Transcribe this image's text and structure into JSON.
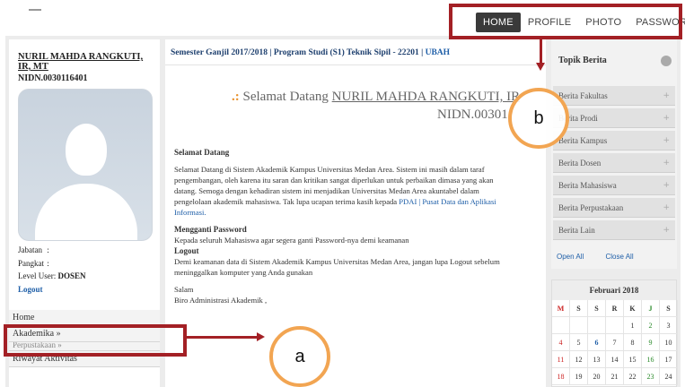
{
  "topnav": {
    "items": [
      "HOME",
      "PROFILE",
      "PHOTO",
      "PASSWORD"
    ],
    "active": "HOME"
  },
  "user": {
    "name": "NURIL MAHDA RANGKUTI, IR, MT",
    "nidn": "NIDN.0030116401",
    "jabatan_label": "Jabatan",
    "jabatan_value": ":",
    "pangkat_label": "Pangkat",
    "pangkat_value": ":",
    "level_label": "Level User:",
    "level_value": "DOSEN",
    "logout": "Logout"
  },
  "menu": {
    "home": "Home",
    "akademika": "Akademika »",
    "perpustakaan": "Perpustakaan »",
    "riwayat": "Riwayat Aktivitas"
  },
  "center": {
    "breadcrumb_main": "Semester Ganjil 2017/2018 | Program Studi (S1) Teknik Sipil - 22201 | ",
    "breadcrumb_link": "UBAH",
    "welcome_prefix": "Selamat Datang",
    "welcome_name": "NURIL MAHDA RANGKUTI, IR",
    "welcome_nidn": "NIDN.00301",
    "sections": {
      "h1": "Selamat Datang",
      "p1": "Selamat Datang di Sistem Akademik Kampus Universitas Medan Area. Sistem ini masih dalam taraf pengembangan, oleh karena itu saran dan kritikan sangat diperlukan untuk perbaikan dimasa yang akan datang. Semoga dengan kehadiran sistem ini menjadikan Universitas Medan Area akuntabel dalam pengelolaan akademik mahasiswa. Tak lupa ucapan terima kasih kepada ",
      "p1_link": "PDAI | Pusat Data dan Aplikasi Informasi.",
      "h2": "Mengganti Password",
      "p2": "Kepada seluruh Mahasiswa agar segera ganti Password-nya demi keamanan",
      "h3": "Logout",
      "p3": "Demi keamanan data di Sistem Akademik Kampus Universitas Medan Area, jangan lupa Logout sebelum meninggalkan komputer yang Anda gunakan",
      "salam": "Salam",
      "sign": "Biro Administrasi Akademik ,"
    }
  },
  "right": {
    "title": "Topik Berita",
    "items": [
      "Berita Fakultas",
      "Berita Prodi",
      "Berita Kampus",
      "Berita Dosen",
      "Berita Mahasiswa",
      "Berita Perpustakaan",
      "Berita Lain"
    ],
    "plus": "+",
    "open_all": "Open All",
    "close_all": "Close All"
  },
  "calendar": {
    "title": "Februari 2018",
    "days": [
      "M",
      "S",
      "S",
      "R",
      "K",
      "J",
      "S"
    ],
    "rows": [
      [
        "",
        "",
        "",
        "",
        "1",
        "2",
        "3"
      ],
      [
        "4",
        "5",
        "6",
        "7",
        "8",
        "9",
        "10"
      ],
      [
        "11",
        "12",
        "13",
        "14",
        "15",
        "16",
        "17"
      ],
      [
        "18",
        "19",
        "20",
        "21",
        "22",
        "23",
        "24"
      ]
    ]
  },
  "annotations": {
    "a": "a",
    "b": "b"
  },
  "colors": {
    "annotation_red": "#a32025",
    "annotation_orange": "#f2a552",
    "link_blue": "#1f5fa8",
    "active_nav": "#3a3a3a"
  }
}
